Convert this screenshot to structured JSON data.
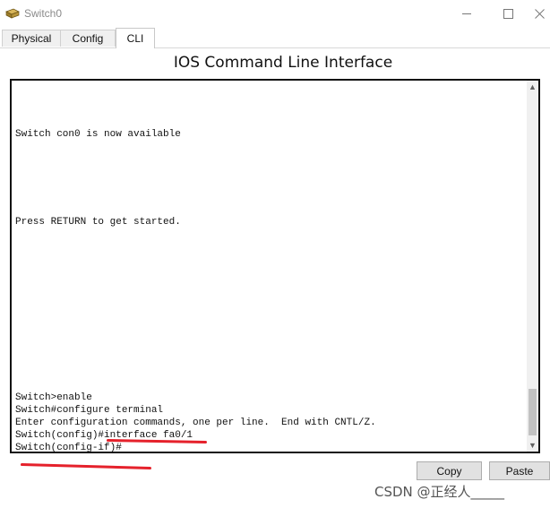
{
  "window": {
    "title": "Switch0",
    "icon": "switch-device-icon",
    "controls": {
      "minimize": "minimize-icon",
      "maximize": "maximize-icon",
      "close": "close-icon"
    }
  },
  "tabs": [
    {
      "label": "Physical",
      "active": false
    },
    {
      "label": "Config",
      "active": false
    },
    {
      "label": "CLI",
      "active": true
    }
  ],
  "panel": {
    "title": "IOS Command Line Interface"
  },
  "terminal": {
    "lines": [
      "Switch con0 is now available",
      "Press RETURN to get started.",
      "Switch>enable",
      "Switch#configure terminal",
      "Enter configuration commands, one per line.  End with CNTL/Z.",
      "Switch(config)#interface fa0/1",
      "Switch(config-if)#"
    ],
    "scroll_up_glyph": "▲",
    "scroll_down_glyph": "▼"
  },
  "buttons": {
    "copy": "Copy",
    "paste": "Paste"
  },
  "watermark": "CSDN @正经人_____",
  "colors": {
    "annotation": "#e5212b",
    "terminal_border": "#111111"
  }
}
